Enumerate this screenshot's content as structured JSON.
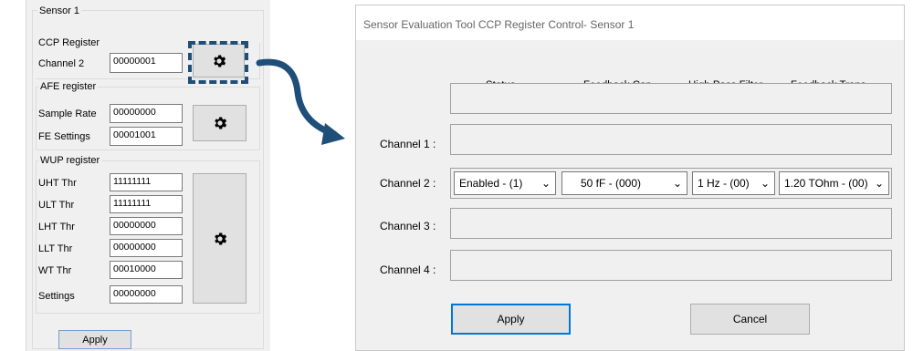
{
  "left": {
    "sensor_group": "Sensor 1",
    "ccp": {
      "title": "CCP Register",
      "channel_label": "Channel 2",
      "channel_value": "00000001"
    },
    "afe": {
      "title": "AFE register",
      "sample_rate_label": "Sample Rate",
      "sample_rate_value": "00000000",
      "fe_settings_label": "FE Settings",
      "fe_settings_value": "00001001"
    },
    "wup": {
      "title": "WUP register",
      "rows": [
        {
          "label": "UHT Thr",
          "value": "11111111"
        },
        {
          "label": "ULT Thr",
          "value": "11111111"
        },
        {
          "label": "LHT Thr",
          "value": "00000000"
        },
        {
          "label": "LLT Thr",
          "value": "00000000"
        },
        {
          "label": "WT Thr",
          "value": "00010000"
        },
        {
          "label": "Settings",
          "value": "00000000"
        }
      ]
    },
    "apply_label": "Apply"
  },
  "dialog": {
    "title": "Sensor Evaluation Tool CCP Register Control- Sensor 1",
    "headers": [
      "Status",
      "Feedback Cap.",
      "High Pass Filter",
      "Feedback Trans."
    ],
    "channels": [
      "Channel 1 :",
      "Channel 2 :",
      "Channel 3 :",
      "Channel 4 :"
    ],
    "channel2": {
      "status": "Enabled  - (1)",
      "feedback_cap": "50 fF  - (000)",
      "high_pass": "1 Hz  - (00)",
      "feedback_trans": "1.20 TOhm  - (00)"
    },
    "apply_label": "Apply",
    "cancel_label": "Cancel"
  },
  "colors": {
    "accent": "#1f4e79",
    "focus_border": "#0078d7"
  },
  "icons": [
    "gear-icon",
    "chevron-down-icon",
    "curved-arrow-icon"
  ]
}
